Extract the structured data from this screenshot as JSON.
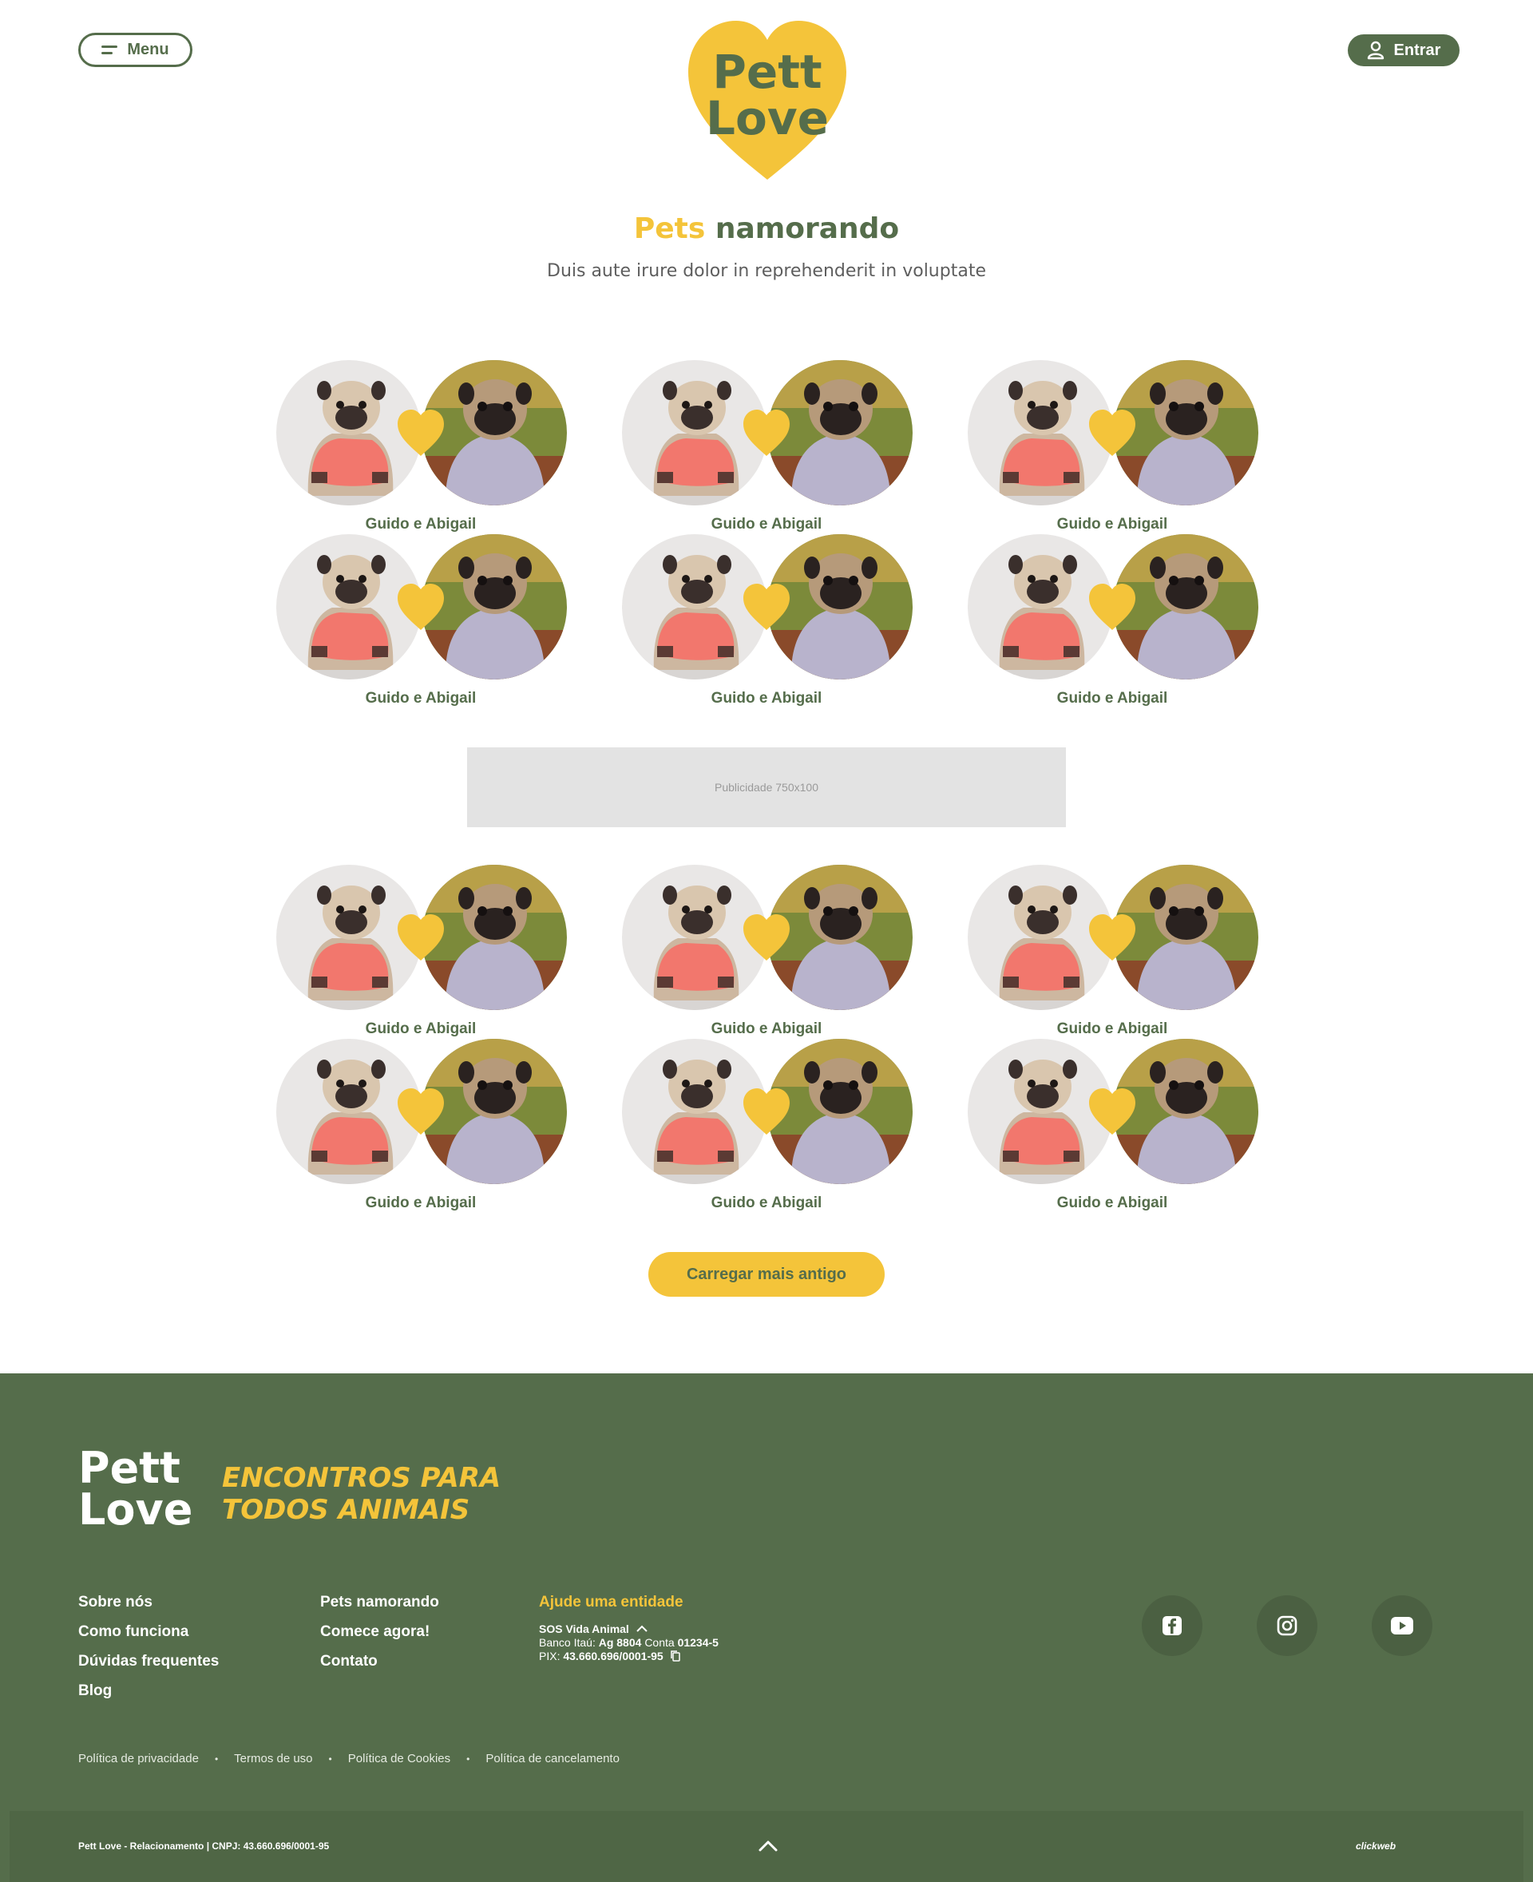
{
  "header": {
    "menu_label": "Menu",
    "logo_line1": "Pett",
    "logo_line2": "Love",
    "login_label": "Entrar"
  },
  "page": {
    "title_highlight": "Pets",
    "title_rest": "namorando",
    "subtitle": "Duis aute irure dolor in reprehenderit in voluptate"
  },
  "couples_group1": [
    {
      "name": "Guido e Abigail"
    },
    {
      "name": "Guido e Abigail"
    },
    {
      "name": "Guido e Abigail"
    },
    {
      "name": "Guido e Abigail"
    },
    {
      "name": "Guido e Abigail"
    },
    {
      "name": "Guido e Abigail"
    }
  ],
  "ad_label": "Publicidade 750x100",
  "couples_group2": [
    {
      "name": "Guido e Abigail"
    },
    {
      "name": "Guido e Abigail"
    },
    {
      "name": "Guido e Abigail"
    },
    {
      "name": "Guido e Abigail"
    },
    {
      "name": "Guido e Abigail"
    },
    {
      "name": "Guido e Abigail"
    }
  ],
  "load_more_label": "Carregar mais antigo",
  "footer": {
    "logo_line1": "Pett",
    "logo_line2": "Love",
    "tagline_line1": "ENCONTROS PARA",
    "tagline_line2": "TODOS ANIMAIS",
    "col1": [
      "Sobre nós",
      "Como funciona",
      "Dúvidas frequentes",
      "Blog"
    ],
    "col2": [
      "Pets namorando",
      "Comece agora!",
      "Contato"
    ],
    "help": {
      "title": "Ajude uma entidade",
      "entity": "SOS Vida Animal",
      "bank_label": "Banco Itaú:",
      "agency": "Ag 8804",
      "account_label": "Conta",
      "account": "01234-5",
      "pix_label": "PIX:",
      "pix": "43.660.696/0001-95"
    },
    "social": [
      "facebook-icon",
      "instagram-icon",
      "youtube-icon"
    ],
    "legal": [
      "Política de privacidade",
      "Termos de uso",
      "Política de Cookies",
      "Política de cancelamento"
    ],
    "copyright": "Pett Love - Relacionamento | CNPJ: 43.660.696/0001-95",
    "credit": "clickweb"
  },
  "colors": {
    "brand_green": "#556d4b",
    "brand_yellow": "#f4c43a"
  }
}
